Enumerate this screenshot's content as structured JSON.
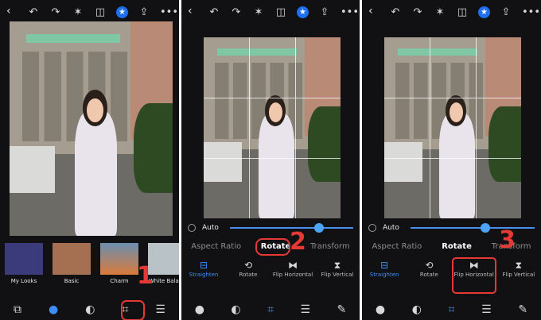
{
  "colors": {
    "accent": "#3d8ef5",
    "highlight": "#e53935",
    "panel_bg": "#111113"
  },
  "toolbar_icons": [
    "undo-icon",
    "redo-icon",
    "magic-wand-icon",
    "compare-icon",
    "star-icon",
    "share-icon",
    "more-icon"
  ],
  "panel1": {
    "back": "‹",
    "looks": [
      {
        "label": "My Looks",
        "color": "#3b3a7a"
      },
      {
        "label": "Basic",
        "color": "#a56f52"
      },
      {
        "label": "Charm",
        "color": "#d97a3a"
      },
      {
        "label": "White Balanc",
        "color": "#b9c3c7"
      }
    ],
    "callout": "1"
  },
  "panel2": {
    "auto_label": "Auto",
    "slider_value": 0.72,
    "tabs": [
      "Aspect Ratio",
      "Rotate",
      "Transform"
    ],
    "active_tab": "Rotate",
    "tools": [
      "Straighten",
      "Rotate",
      "Flip Horizontal",
      "Flip Vertical"
    ],
    "callout": "2"
  },
  "panel3": {
    "auto_label": "Auto",
    "slider_value": 0.6,
    "tabs": [
      "Aspect Ratio",
      "Rotate",
      "Transform"
    ],
    "active_tab": "Rotate",
    "tools": [
      "Straighten",
      "Rotate",
      "Flip Horizontal",
      "Flip Vertical"
    ],
    "callout": "3"
  }
}
